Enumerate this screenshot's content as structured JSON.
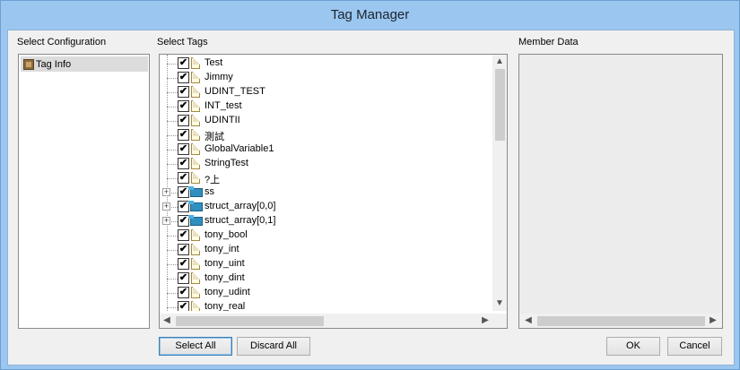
{
  "window": {
    "title": "Tag Manager"
  },
  "config": {
    "label": "Select Configuration",
    "items": [
      {
        "label": "Tag Info",
        "icon": "book-icon"
      }
    ]
  },
  "tags": {
    "label": "Select Tags",
    "items": [
      {
        "label": "Test",
        "checked": true,
        "type": "tag"
      },
      {
        "label": "Jimmy",
        "checked": true,
        "type": "tag"
      },
      {
        "label": "UDINT_TEST",
        "checked": true,
        "type": "tag"
      },
      {
        "label": "INT_test",
        "checked": true,
        "type": "tag"
      },
      {
        "label": "UDINTII",
        "checked": true,
        "type": "tag"
      },
      {
        "label": "測試",
        "checked": true,
        "type": "tag"
      },
      {
        "label": "GlobalVariable1",
        "checked": true,
        "type": "tag"
      },
      {
        "label": "StringTest",
        "checked": true,
        "type": "tag"
      },
      {
        "label": "?上",
        "checked": true,
        "type": "tag"
      },
      {
        "label": "ss",
        "checked": true,
        "type": "struct",
        "expandable": true
      },
      {
        "label": "struct_array[0,0]",
        "checked": true,
        "type": "struct",
        "expandable": true
      },
      {
        "label": "struct_array[0,1]",
        "checked": true,
        "type": "struct",
        "expandable": true
      },
      {
        "label": "tony_bool",
        "checked": true,
        "type": "tag"
      },
      {
        "label": "tony_int",
        "checked": true,
        "type": "tag"
      },
      {
        "label": "tony_uint",
        "checked": true,
        "type": "tag"
      },
      {
        "label": "tony_dint",
        "checked": true,
        "type": "tag"
      },
      {
        "label": "tony_udint",
        "checked": true,
        "type": "tag"
      },
      {
        "label": "tony_real",
        "checked": true,
        "type": "tag"
      }
    ],
    "check_glyph": "✔",
    "expander_glyph": "+"
  },
  "member": {
    "label": "Member Data"
  },
  "scroll": {
    "up": "▲",
    "down": "▼",
    "left": "◀",
    "right": "▶"
  },
  "buttons": {
    "select_all": "Select All",
    "discard_all": "Discard All",
    "ok": "OK",
    "cancel": "Cancel"
  }
}
